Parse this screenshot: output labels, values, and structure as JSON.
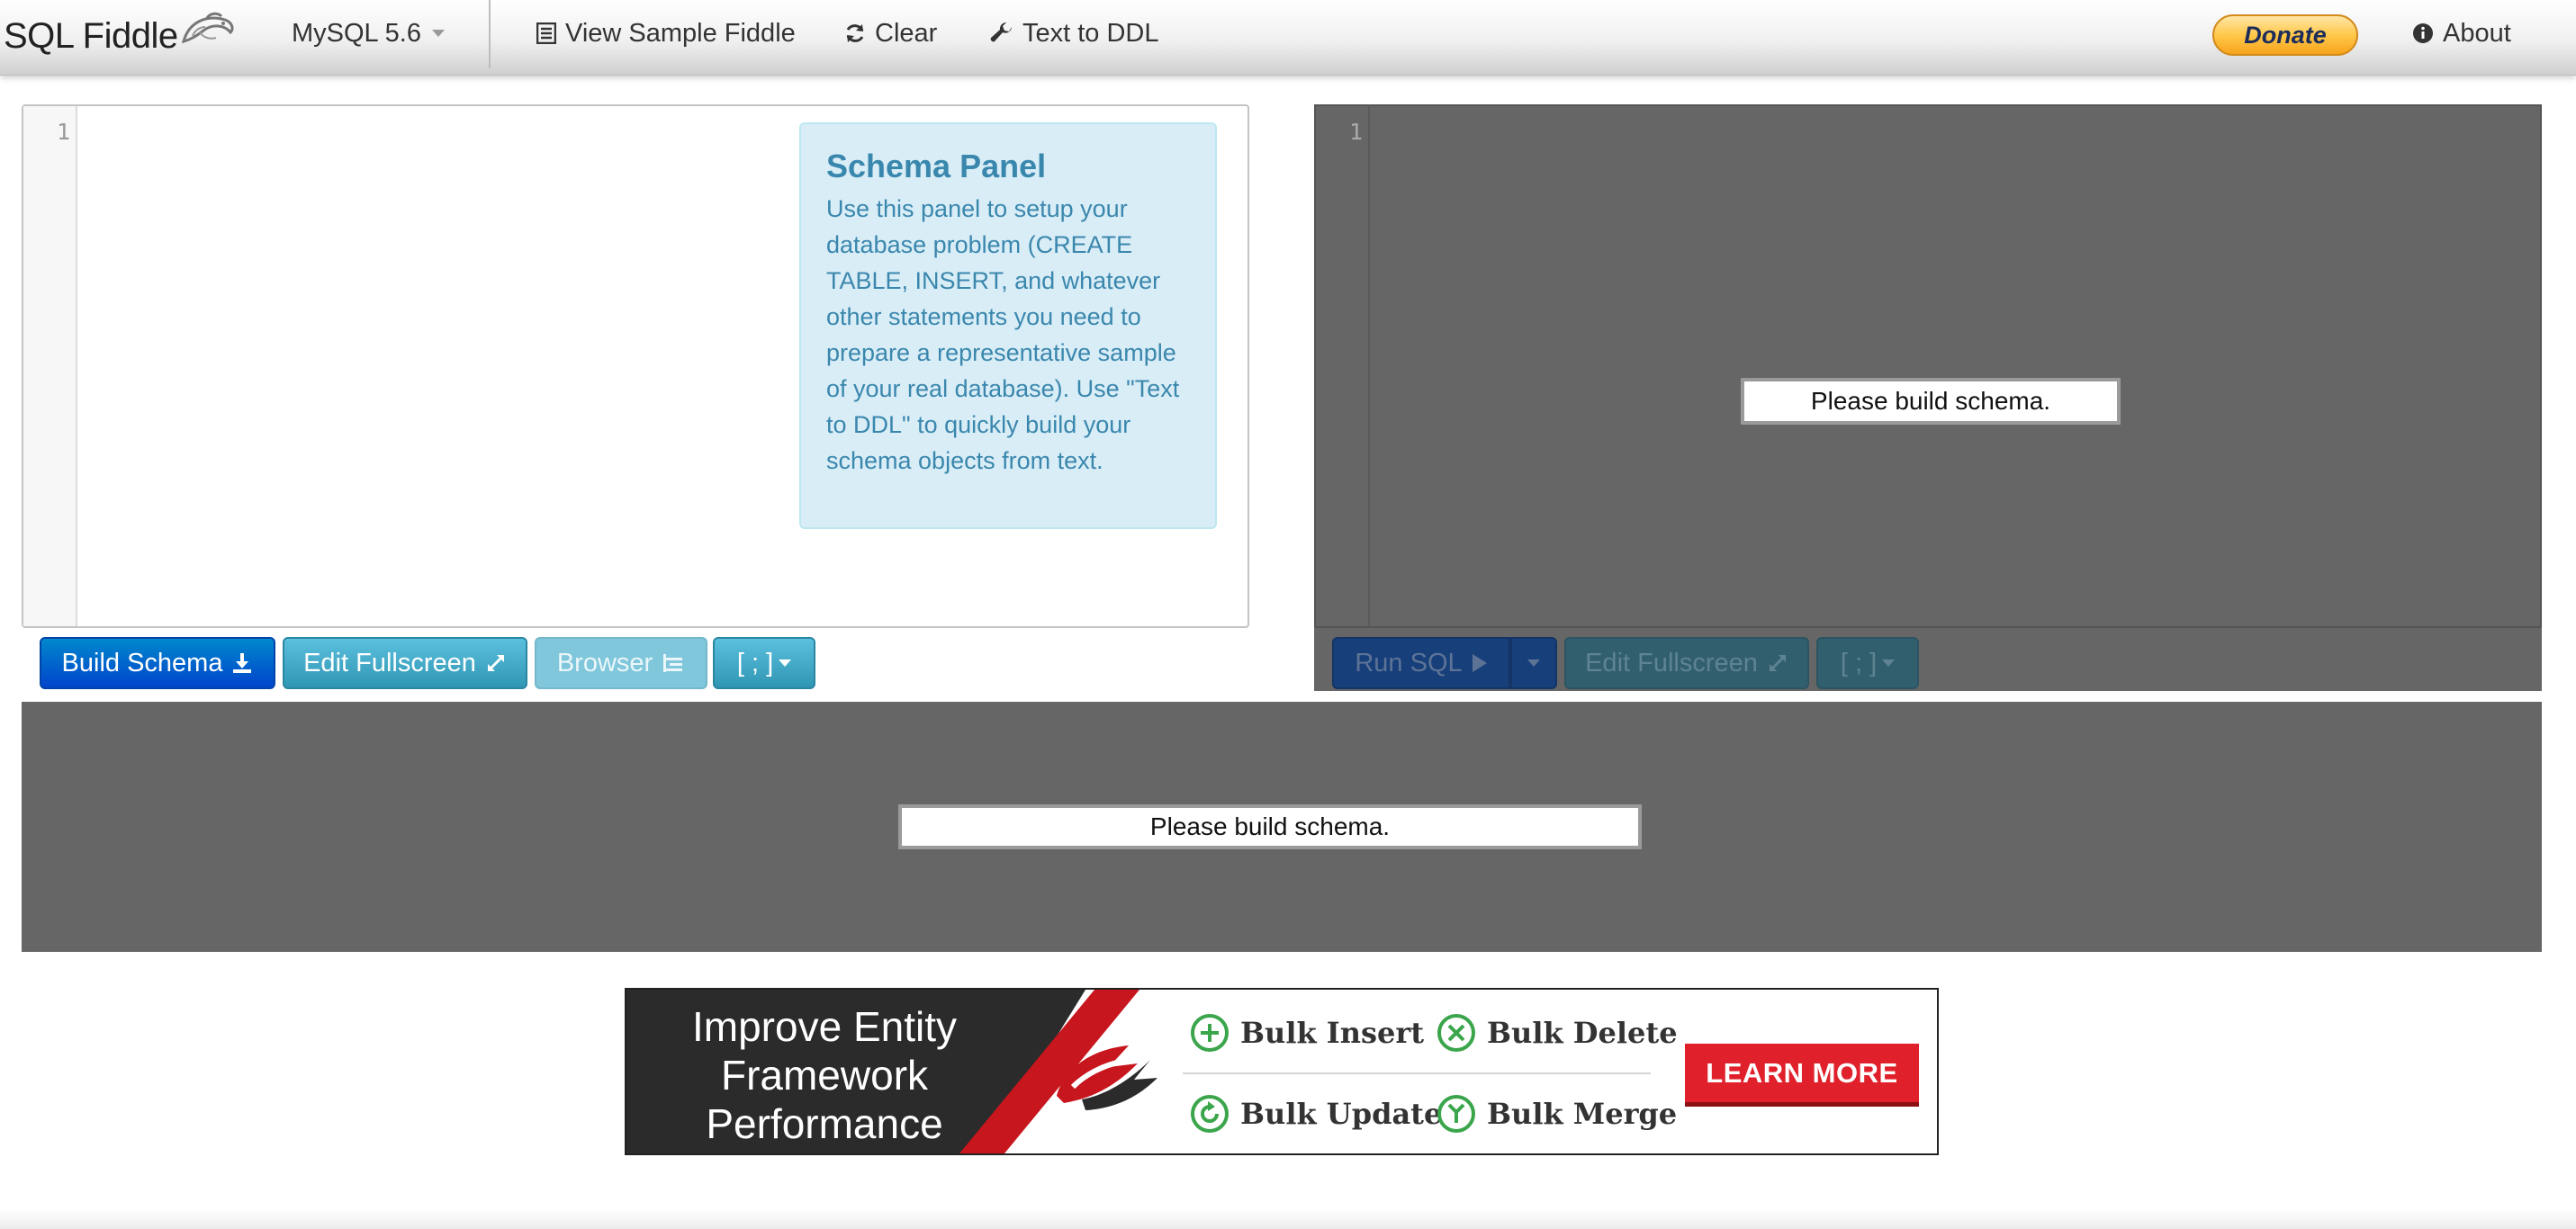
{
  "navbar": {
    "brand": "SQL Fiddle",
    "db_version": "MySQL 5.6",
    "view_sample": "View Sample Fiddle",
    "clear": "Clear",
    "text_to_ddl": "Text to DDL",
    "donate": "Donate",
    "about": "About"
  },
  "schema_panel": {
    "line_number": "1",
    "help_title": "Schema Panel",
    "help_text": "Use this panel to setup your database problem (CREATE TABLE, INSERT, and whatever other statements you need to prepare a representative sample of your real database). Use \"Text to DDL\" to quickly build your schema objects from text.",
    "build_button": "Build Schema",
    "fullscreen_button": "Edit Fullscreen",
    "browser_button": "Browser",
    "terminator_button": "[ ; ]"
  },
  "query_panel": {
    "line_number": "1",
    "message": "Please build schema.",
    "run_button": "Run SQL",
    "fullscreen_button": "Edit Fullscreen",
    "terminator_button": "[ ; ]"
  },
  "results": {
    "message": "Please build schema."
  },
  "ad": {
    "headline_line1": "Improve Entity",
    "headline_line2": "Framework",
    "headline_line3": "Performance",
    "feature1": "Bulk Insert",
    "feature2": "Bulk Delete",
    "feature3": "Bulk Update",
    "feature4": "Bulk Merge",
    "cta": "LEARN MORE"
  }
}
